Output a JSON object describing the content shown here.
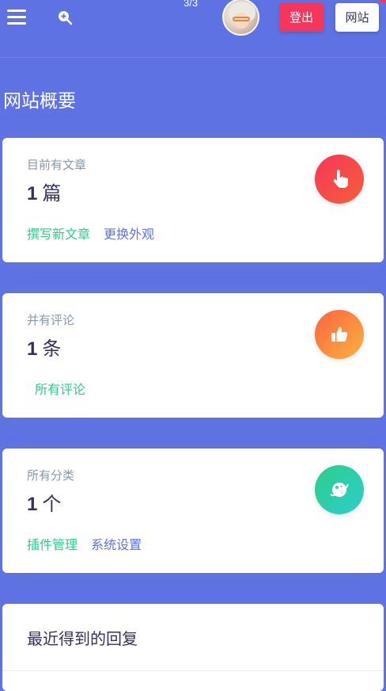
{
  "header": {
    "menu_icon": "hamburger-menu-icon",
    "search_icon": "zoom-in-icon",
    "page_counter": "3/3",
    "logout_label": "登出",
    "site_label": "网站"
  },
  "title": "网站概要",
  "cards": [
    {
      "label": "目前有文章",
      "count": "1",
      "unit": "篇",
      "icon": "hand-pointer-icon",
      "links": [
        "撰写新文章",
        "更换外观"
      ]
    },
    {
      "label": "并有评论",
      "count": "1",
      "unit": "条",
      "icon": "thumbs-up-icon",
      "links": [
        "所有评论"
      ]
    },
    {
      "label": "所有分类",
      "count": "1",
      "unit": "个",
      "icon": "planet-icon",
      "links": [
        "插件管理",
        "系统设置"
      ]
    }
  ],
  "replies": {
    "heading": "最近得到的回复"
  },
  "colors": {
    "background": "#5e72e4",
    "logout_button": "#f5365c",
    "link_green": "#2dce89",
    "link_blue": "#5e72e4"
  }
}
